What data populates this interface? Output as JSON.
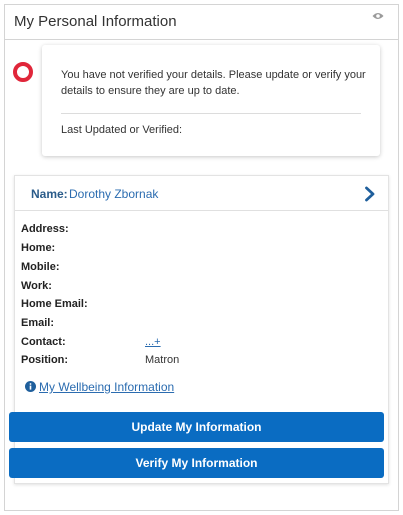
{
  "panel": {
    "title": "My Personal Information",
    "header_icon": "eye-icon"
  },
  "alert": {
    "status_icon": "ring-icon",
    "status_color": "#e0263a",
    "message": "You have not verified your details. Please update or verify your details to ensure they are up to date.",
    "last_updated_label": "Last Updated or Verified:"
  },
  "profile": {
    "name_label": "Name:",
    "name_value": "Dorothy Zbornak",
    "chevron_icon": "chevron-right-icon",
    "fields": [
      {
        "label": "Address:",
        "value": ""
      },
      {
        "label": "Home:",
        "value": ""
      },
      {
        "label": "Mobile:",
        "value": ""
      },
      {
        "label": "Work:",
        "value": ""
      },
      {
        "label": "Home Email:",
        "value": ""
      },
      {
        "label": "Email:",
        "value": ""
      },
      {
        "label": "Contact:",
        "value": "...+"
      },
      {
        "label": "Position:",
        "value": "Matron"
      }
    ],
    "wellbeing_icon": "info-icon",
    "wellbeing_link": "My Wellbeing Information"
  },
  "actions": {
    "update_label": "Update My Information",
    "verify_label": "Verify My Information",
    "button_color": "#0a6cc2"
  }
}
